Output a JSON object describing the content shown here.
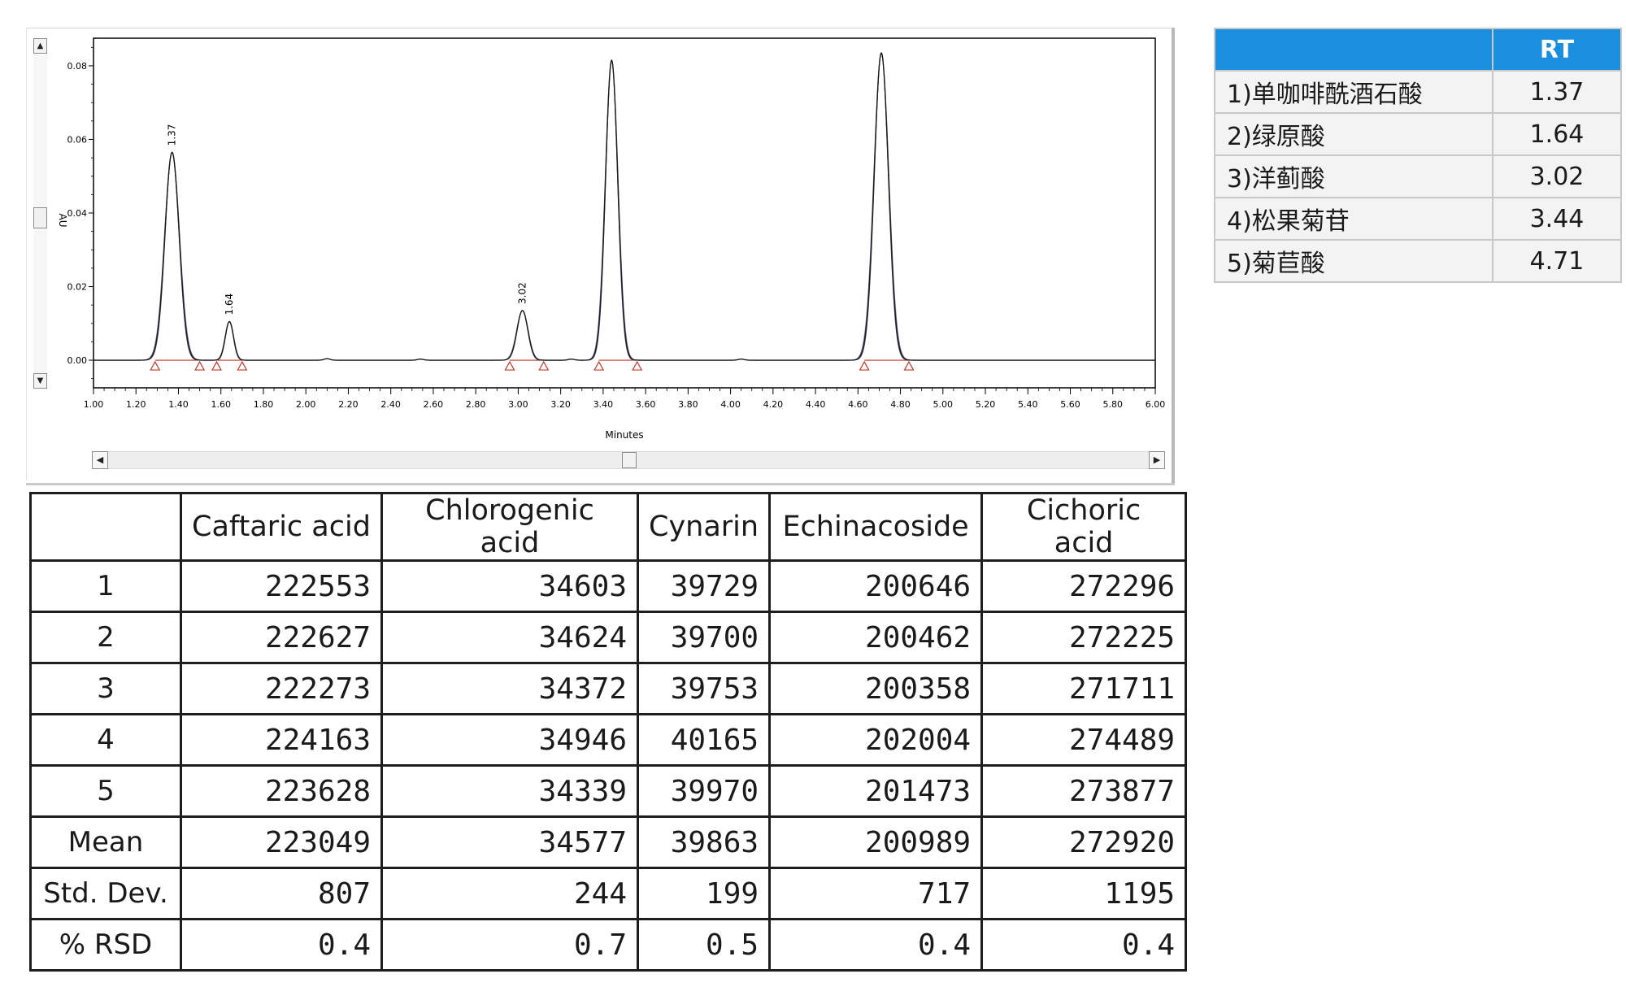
{
  "chart_data": {
    "type": "line",
    "xlabel": "Minutes",
    "ylabel": "AU",
    "xlim": [
      1.0,
      6.0
    ],
    "ylim": [
      -0.0075,
      0.0875
    ],
    "x_ticks": [
      "1.00",
      "1.20",
      "1.40",
      "1.60",
      "1.80",
      "2.00",
      "2.20",
      "2.40",
      "2.60",
      "2.80",
      "3.00",
      "3.20",
      "3.40",
      "3.60",
      "3.80",
      "4.00",
      "4.20",
      "4.40",
      "4.60",
      "4.80",
      "5.00",
      "5.20",
      "5.40",
      "5.60",
      "5.80",
      "6.00"
    ],
    "y_ticks": [
      "0.00",
      "0.02",
      "0.04",
      "0.06",
      "0.08"
    ],
    "grid": false,
    "peaks": [
      {
        "rt": 1.37,
        "height": 0.0565,
        "label": "1.37",
        "start": 1.29,
        "end": 1.5
      },
      {
        "rt": 1.64,
        "height": 0.0105,
        "label": "1.64",
        "start": 1.58,
        "end": 1.7
      },
      {
        "rt": 3.02,
        "height": 0.0135,
        "label": "3.02",
        "start": 2.96,
        "end": 3.12
      },
      {
        "rt": 3.44,
        "height": 0.0815,
        "label": "",
        "start": 3.38,
        "end": 3.56
      },
      {
        "rt": 4.71,
        "height": 0.0835,
        "label": "",
        "start": 4.63,
        "end": 4.84
      }
    ],
    "colors": {
      "trace": "#1a1a1a",
      "fit": "#c0392b",
      "overlay": "#6b4fa0",
      "marker": "#c0392b",
      "axis": "#000000"
    }
  },
  "rt_table": {
    "header": [
      "",
      "RT"
    ],
    "rows": [
      {
        "name": "1)单咖啡酰酒石酸",
        "rt": "1.37"
      },
      {
        "name": "2)绿原酸",
        "rt": "1.64"
      },
      {
        "name": "3)洋蓟酸",
        "rt": "3.02"
      },
      {
        "name": "4)松果菊苷",
        "rt": "3.44"
      },
      {
        "name": "5)菊苣酸",
        "rt": "4.71"
      }
    ],
    "header_color": "#1a8fe0"
  },
  "area_table": {
    "columns": [
      "",
      "Caftaric acid",
      "Chlorogenic acid",
      "Cynarin",
      "Echinacoside",
      "Cichoric acid"
    ],
    "rows": [
      {
        "label": "1",
        "values": [
          "222553",
          "34603",
          "39729",
          "200646",
          "272296"
        ]
      },
      {
        "label": "2",
        "values": [
          "222627",
          "34624",
          "39700",
          "200462",
          "272225"
        ]
      },
      {
        "label": "3",
        "values": [
          "222273",
          "34372",
          "39753",
          "200358",
          "271711"
        ]
      },
      {
        "label": "4",
        "values": [
          "224163",
          "34946",
          "40165",
          "202004",
          "274489"
        ]
      },
      {
        "label": "5",
        "values": [
          "223628",
          "34339",
          "39970",
          "201473",
          "273877"
        ]
      },
      {
        "label": "Mean",
        "values": [
          "223049",
          "34577",
          "39863",
          "200989",
          "272920"
        ]
      },
      {
        "label": "Std. Dev.",
        "values": [
          "807",
          "244",
          "199",
          "717",
          "1195"
        ]
      },
      {
        "label": "% RSD",
        "values": [
          "0.4",
          "0.7",
          "0.5",
          "0.4",
          "0.4"
        ]
      }
    ]
  },
  "scroll": {
    "up_icon": "▲",
    "down_icon": "▼",
    "left_icon": "◀",
    "right_icon": "▶"
  }
}
